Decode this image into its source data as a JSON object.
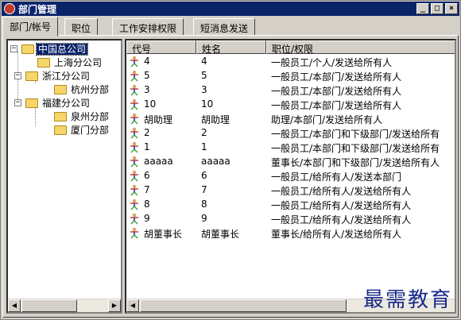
{
  "window": {
    "title": "部门管理",
    "minimize": "_",
    "maximize": "□",
    "close": "×"
  },
  "tabs": [
    "部门/帐号",
    "职位",
    "工作安排权限",
    "短消息发送"
  ],
  "tree": {
    "root": "中国总公司",
    "nodes": [
      "上海分公司",
      "浙江分公司",
      "杭州分部",
      "福建分公司",
      "泉州分部",
      "厦门分部"
    ]
  },
  "list": {
    "columns": [
      "代号",
      "姓名",
      "职位/权限"
    ],
    "rows": [
      [
        "4",
        "4",
        "一般员工/个人/发送给所有人"
      ],
      [
        "5",
        "5",
        "一般员工/本部门/发送给所有人"
      ],
      [
        "3",
        "3",
        "一般员工/本部门/发送给所有人"
      ],
      [
        "10",
        "10",
        "一般员工/本部门/发送给所有人"
      ],
      [
        "胡助理",
        "胡助理",
        "助理/本部门/发送给所有人"
      ],
      [
        "2",
        "2",
        "一般员工/本部门和下级部门/发送给所有"
      ],
      [
        "1",
        "1",
        "一般员工/本部门和下级部门/发送给所有"
      ],
      [
        "aaaaa",
        "aaaaa",
        "董事长/本部门和下级部门/发送给所有人"
      ],
      [
        "6",
        "6",
        "一般员工/给所有人/发送本部门"
      ],
      [
        "7",
        "7",
        "一般员工/给所有人/发送给所有人"
      ],
      [
        "8",
        "8",
        "一般员工/给所有人/发送给所有人"
      ],
      [
        "9",
        "9",
        "一般员工/给所有人/发送给所有人"
      ],
      [
        "胡董事长",
        "胡董事长",
        "董事长/给所有人/发送给所有人"
      ]
    ]
  },
  "watermark": "最需教育",
  "colors": {
    "titlebar": "#0a246a",
    "selection": "#0a246a",
    "folder": "#f6d66b"
  }
}
